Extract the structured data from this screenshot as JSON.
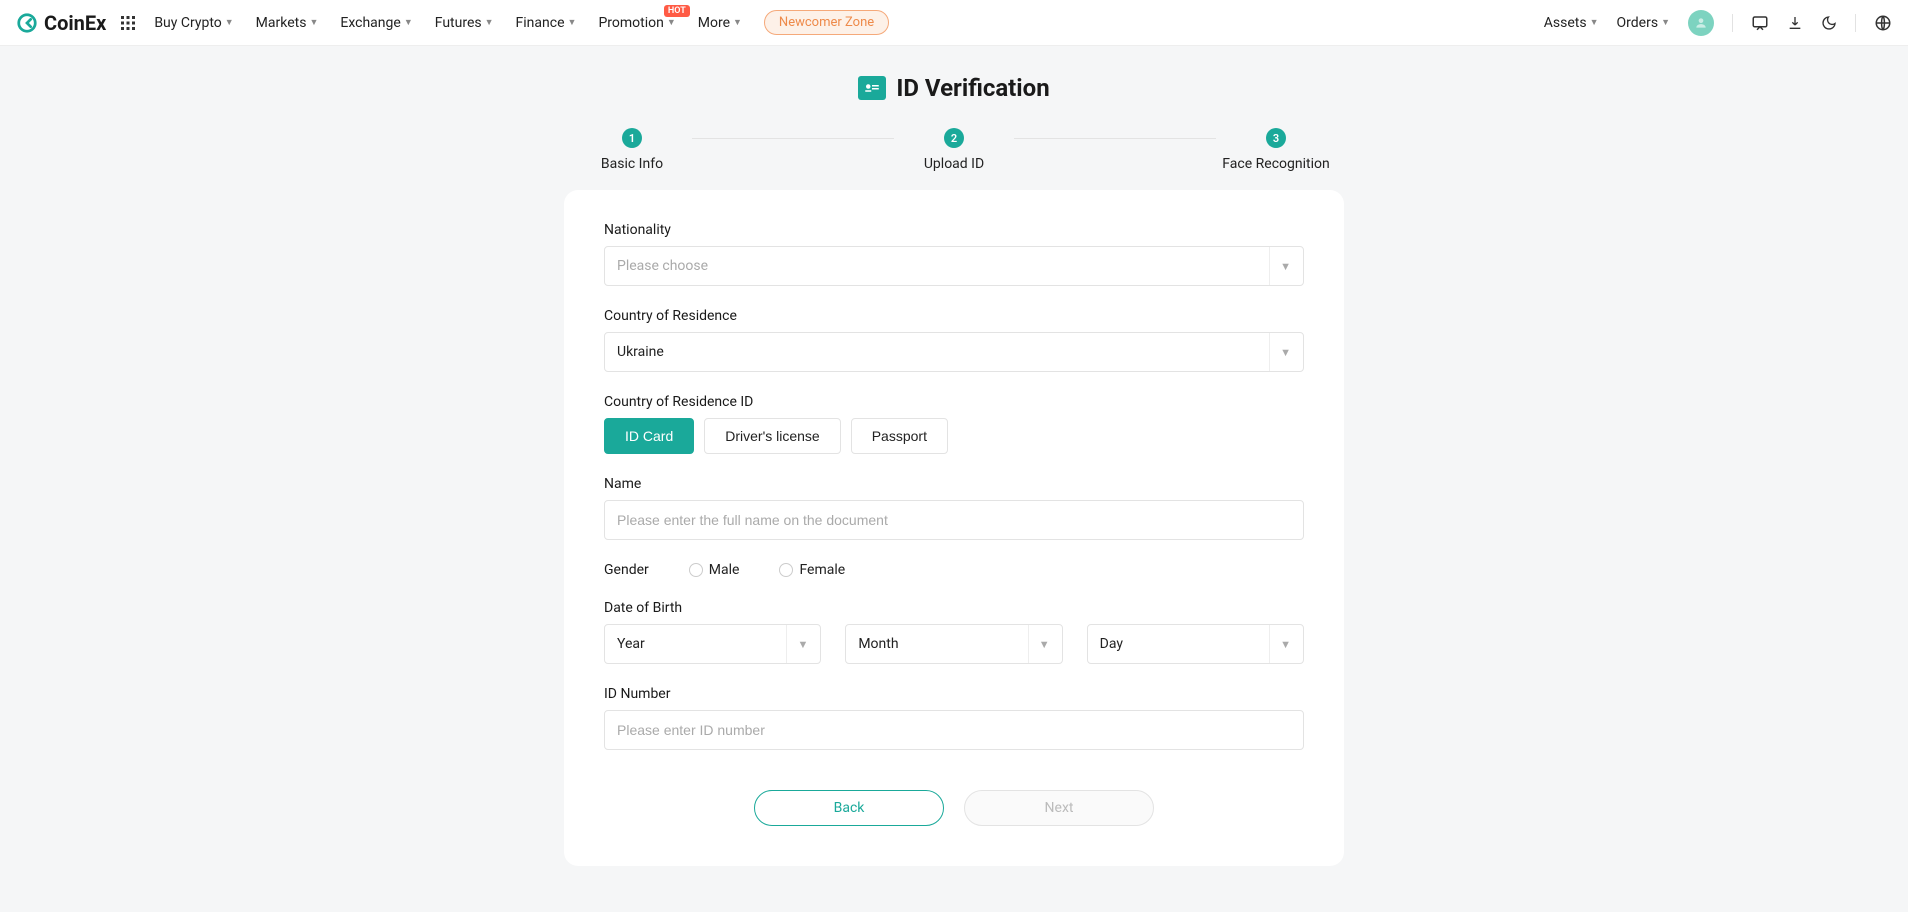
{
  "header": {
    "brand": "CoinEx",
    "nav": {
      "buy_crypto": "Buy Crypto",
      "markets": "Markets",
      "exchange": "Exchange",
      "futures": "Futures",
      "finance": "Finance",
      "promotion": "Promotion",
      "promotion_badge": "HOT",
      "more": "More",
      "newcomer": "Newcomer Zone",
      "assets": "Assets",
      "orders": "Orders"
    }
  },
  "page": {
    "title": "ID Verification",
    "steps": {
      "s1_num": "1",
      "s1_label": "Basic Info",
      "s2_num": "2",
      "s2_label": "Upload ID",
      "s3_num": "3",
      "s3_label": "Face Recognition"
    },
    "form": {
      "nationality_label": "Nationality",
      "nationality_placeholder": "Please choose",
      "country_label": "Country of Residence",
      "country_value": "Ukraine",
      "id_type_label": "Country of Residence ID",
      "id_type_options": {
        "id_card": "ID Card",
        "drivers_license": "Driver's license",
        "passport": "Passport"
      },
      "name_label": "Name",
      "name_placeholder": "Please enter the full name on the document",
      "gender_label": "Gender",
      "gender_male": "Male",
      "gender_female": "Female",
      "dob_label": "Date of Birth",
      "dob_year": "Year",
      "dob_month": "Month",
      "dob_day": "Day",
      "id_number_label": "ID Number",
      "id_number_placeholder": "Please enter ID number"
    },
    "actions": {
      "back": "Back",
      "next": "Next"
    }
  }
}
